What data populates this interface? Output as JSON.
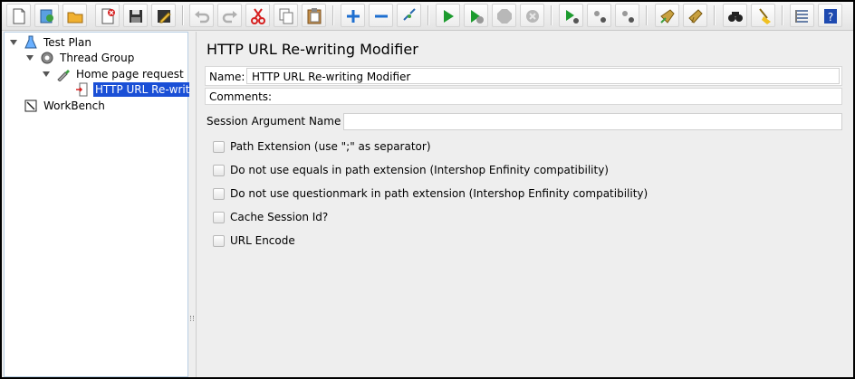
{
  "toolbar": {
    "buttons": [
      {
        "icon": "new-document-icon"
      },
      {
        "icon": "templates-icon"
      },
      {
        "icon": "open-folder-icon"
      },
      {
        "icon": "close-icon"
      },
      {
        "icon": "save-icon"
      },
      {
        "icon": "save-as-icon"
      },
      {
        "icon": "undo-icon"
      },
      {
        "icon": "redo-icon"
      },
      {
        "icon": "cut-icon"
      },
      {
        "icon": "copy-icon"
      },
      {
        "icon": "paste-icon"
      },
      {
        "icon": "expand-icon"
      },
      {
        "icon": "collapse-icon"
      },
      {
        "icon": "toggle-icon"
      },
      {
        "icon": "start-icon"
      },
      {
        "icon": "start-no-pause-icon"
      },
      {
        "icon": "stop-icon"
      },
      {
        "icon": "shutdown-icon"
      },
      {
        "icon": "remote-start-icon"
      },
      {
        "icon": "remote-stop-icon"
      },
      {
        "icon": "remote-shutdown-icon"
      },
      {
        "icon": "clear-icon"
      },
      {
        "icon": "clear-all-icon"
      },
      {
        "icon": "search-icon"
      },
      {
        "icon": "reset-search-icon"
      },
      {
        "icon": "function-helper-icon"
      },
      {
        "icon": "help-icon"
      }
    ],
    "help_glyph": "?"
  },
  "tree": {
    "test_plan": "Test Plan",
    "thread_group": "Thread Group",
    "home_page_request": "Home page request",
    "url_rewriting": "HTTP URL Re-writi",
    "workbench": "WorkBench"
  },
  "main": {
    "title": "HTTP URL Re-writing Modifier",
    "name_label": "Name:",
    "name_value": "HTTP URL Re-writing Modifier",
    "comments_label": "Comments:",
    "session_label": "Session Argument Name",
    "session_value": "",
    "checkboxes": [
      {
        "label": "Path Extension (use \";\" as separator)",
        "checked": false
      },
      {
        "label": "Do not use equals in path extension (Intershop Enfinity compatibility)",
        "checked": false
      },
      {
        "label": "Do not use questionmark in path extension (Intershop Enfinity compatibility)",
        "checked": false
      },
      {
        "label": "Cache Session Id?",
        "checked": false
      },
      {
        "label": "URL Encode",
        "checked": false
      }
    ]
  },
  "colors": {
    "selection": "#1a4fd6",
    "play_green": "#1c9b2e",
    "cut_red": "#d62020",
    "plus_blue": "#1e6fd0"
  }
}
